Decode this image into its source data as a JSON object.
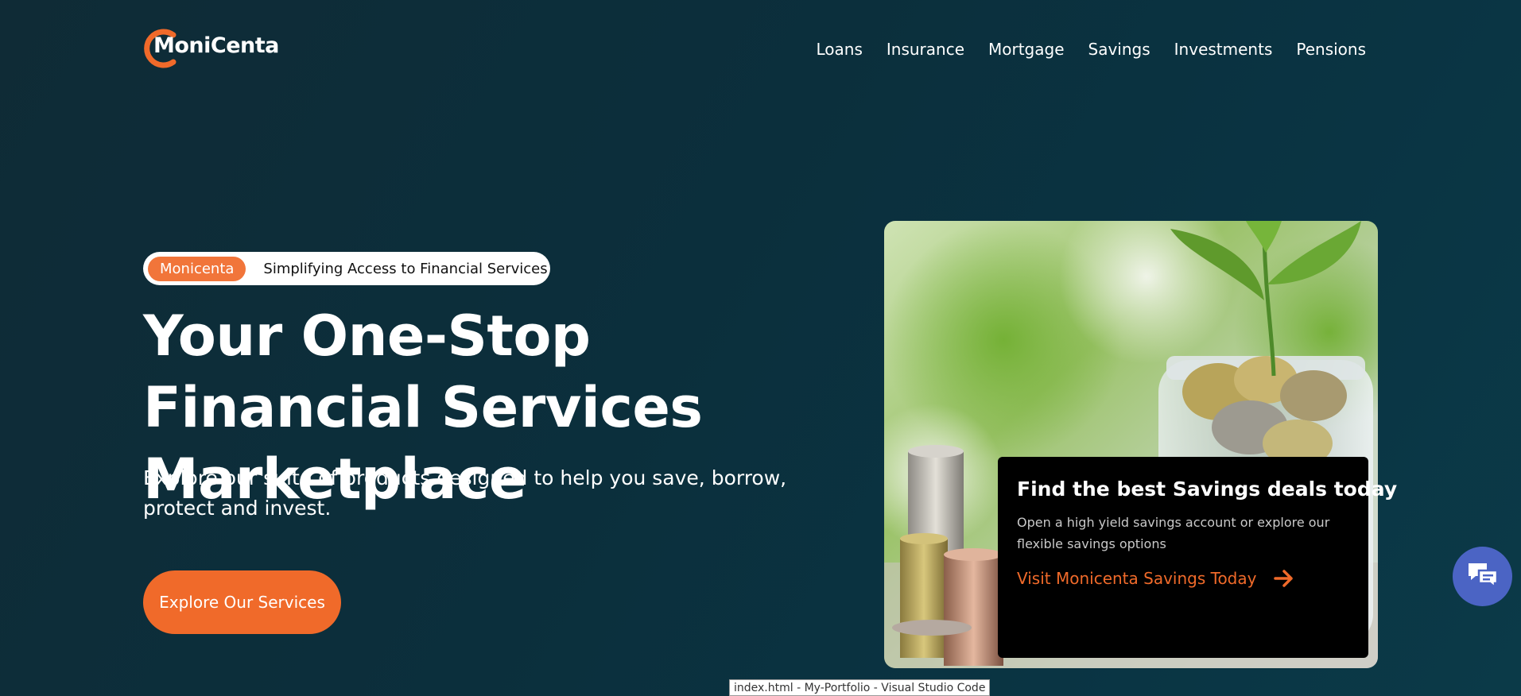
{
  "brand": {
    "name": "MoniCenta",
    "accent": "#f06a2a",
    "background": "#0b2f3c"
  },
  "nav": {
    "items": [
      {
        "label": "Loans"
      },
      {
        "label": "Insurance"
      },
      {
        "label": "Mortgage"
      },
      {
        "label": "Savings"
      },
      {
        "label": "Investments"
      },
      {
        "label": "Pensions"
      }
    ]
  },
  "hero": {
    "tag_pill": "Monicenta",
    "tag_text": "Simplifying Access to Financial Services",
    "title": "Your One-Stop Financial Services Marketplace",
    "subtitle": "Explore our suite of products designed to help you save, borrow, protect and invest.",
    "cta_label": "Explore Our Services"
  },
  "promo": {
    "title": "Find the best Savings deals today",
    "description": "Open a high yield savings account or explore our flexible savings options",
    "link_label": "Visit Monicenta Savings Today",
    "link_icon": "arrow-right-icon"
  },
  "chat": {
    "icon": "chat-bubbles-icon",
    "color": "#4b64c4"
  },
  "tooltip": {
    "text": "index.html - My-Portfolio - Visual Studio Code"
  }
}
